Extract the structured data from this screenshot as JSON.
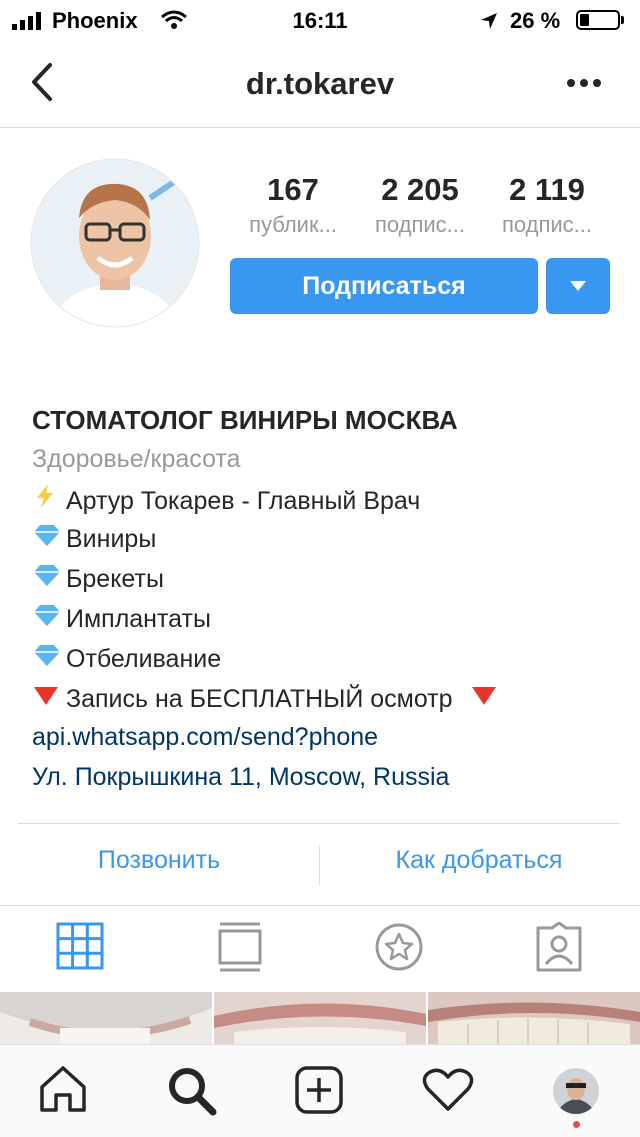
{
  "status_bar": {
    "carrier": "Phoenix",
    "time": "16:11",
    "battery_percent": "26 %",
    "battery_level": 0.26
  },
  "nav": {
    "username": "dr.tokarev"
  },
  "stats": [
    {
      "value": "167",
      "label": "публик..."
    },
    {
      "value": "2 205",
      "label": "подпис..."
    },
    {
      "value": "2 119",
      "label": "подпис..."
    }
  ],
  "follow_button": "Подписаться",
  "bio": {
    "name": "СТОМАТОЛОГ ВИНИРЫ МОСКВА",
    "category": "Здоровье/красота",
    "lines": [
      "Артур Токарев - Главный Врач",
      "Виниры",
      "Брекеты",
      "Имплантаты",
      "Отбеливание",
      "Запись на БЕСПЛАТНЫЙ осмотр"
    ],
    "website": "api.whatsapp.com/send?phone",
    "address": "Ул. Покрышкина 11, Moscow, Russia"
  },
  "actions": {
    "call": "Позвонить",
    "directions": "Как добраться"
  },
  "icons": {
    "tabs": [
      "grid-icon",
      "feed-icon",
      "saved-icon",
      "tagged-icon"
    ],
    "bottom": [
      "home-icon",
      "search-icon",
      "add-icon",
      "heart-icon",
      "profile-avatar"
    ]
  },
  "colors": {
    "accent": "#3897f0",
    "link": "#003569",
    "muted": "#999999"
  }
}
